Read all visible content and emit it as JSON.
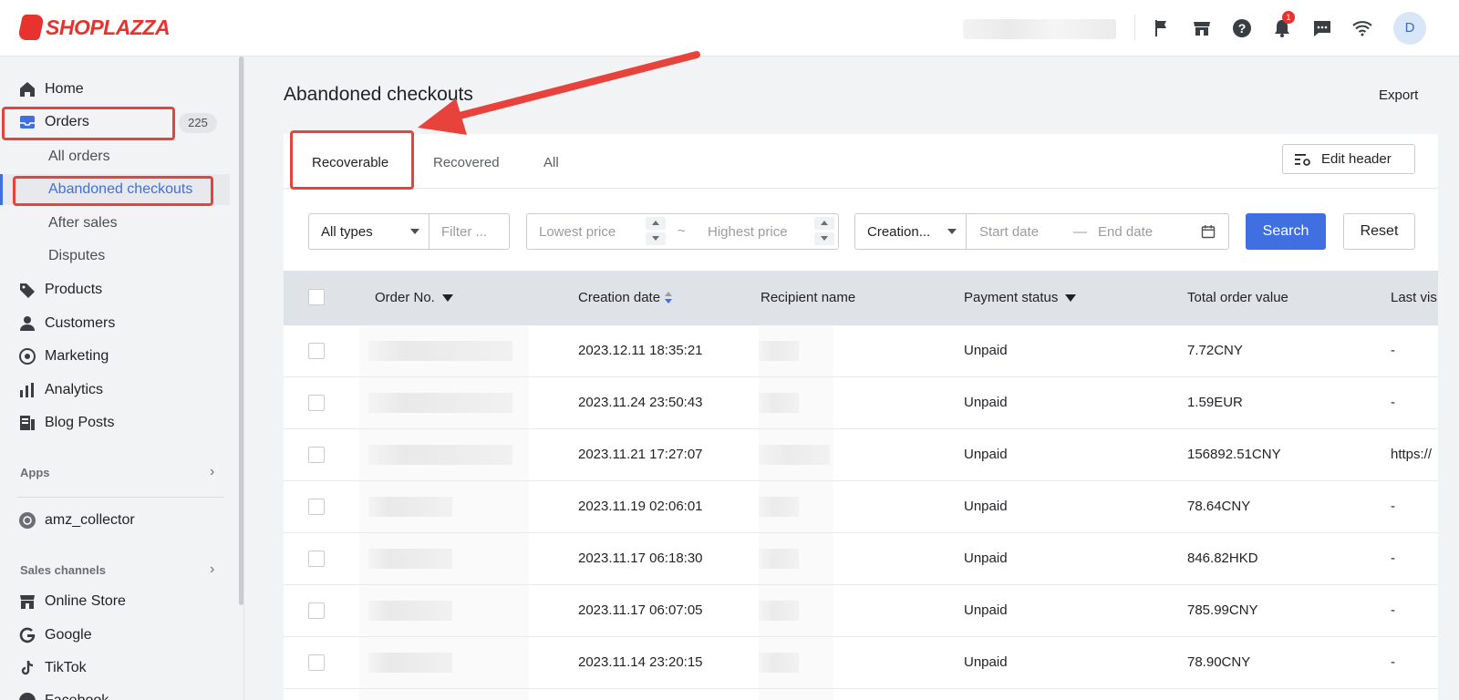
{
  "brand": {
    "name": "SHOPLAZZA",
    "accent": "#e8322e",
    "primary": "#3f6fe0"
  },
  "topbar": {
    "icons": [
      "flag-icon",
      "store-icon",
      "help-icon",
      "bell-icon",
      "chat-icon",
      "wifi-icon"
    ],
    "notification_count": "1",
    "avatar_initial": "D"
  },
  "sidebar": {
    "home": "Home",
    "orders": "Orders",
    "orders_count": "225",
    "sub": {
      "all_orders": "All orders",
      "abandoned": "Abandoned checkouts",
      "after_sales": "After sales",
      "disputes": "Disputes"
    },
    "products": "Products",
    "customers": "Customers",
    "marketing": "Marketing",
    "analytics": "Analytics",
    "blog": "Blog Posts",
    "apps_heading": "Apps",
    "app_item": "amz_collector",
    "sales_heading": "Sales channels",
    "online_store": "Online Store",
    "google": "Google",
    "tiktok": "TikTok",
    "facebook": "Facebook"
  },
  "page": {
    "title": "Abandoned checkouts",
    "export": "Export",
    "tabs": [
      "Recoverable",
      "Recovered",
      "All"
    ],
    "edit_header": "Edit header"
  },
  "filters": {
    "type_value": "All types",
    "filter_placeholder": "Filter ...",
    "lowest_placeholder": "Lowest price",
    "range_sep": "~",
    "highest_placeholder": "Highest price",
    "date_type_value": "Creation...",
    "start_placeholder": "Start date",
    "date_sep": "—",
    "end_placeholder": "End date",
    "search": "Search",
    "reset": "Reset"
  },
  "table": {
    "headers": {
      "order_no": "Order No.",
      "creation_date": "Creation date",
      "recipient": "Recipient name",
      "payment": "Payment status",
      "total": "Total order value",
      "last_visit": "Last vis"
    },
    "rows": [
      {
        "date": "2023.12.11 18:35:21",
        "payment": "Unpaid",
        "total": "7.72CNY",
        "last": "-"
      },
      {
        "date": "2023.11.24 23:50:43",
        "payment": "Unpaid",
        "total": "1.59EUR",
        "last": "-"
      },
      {
        "date": "2023.11.21 17:27:07",
        "payment": "Unpaid",
        "total": "156892.51CNY",
        "last": "https://"
      },
      {
        "date": "2023.11.19 02:06:01",
        "payment": "Unpaid",
        "total": "78.64CNY",
        "last": "-"
      },
      {
        "date": "2023.11.17 06:18:30",
        "payment": "Unpaid",
        "total": "846.82HKD",
        "last": "-"
      },
      {
        "date": "2023.11.17 06:07:05",
        "payment": "Unpaid",
        "total": "785.99CNY",
        "last": "-"
      },
      {
        "date": "2023.11.14 23:20:15",
        "payment": "Unpaid",
        "total": "78.90CNY",
        "last": "-"
      }
    ]
  }
}
